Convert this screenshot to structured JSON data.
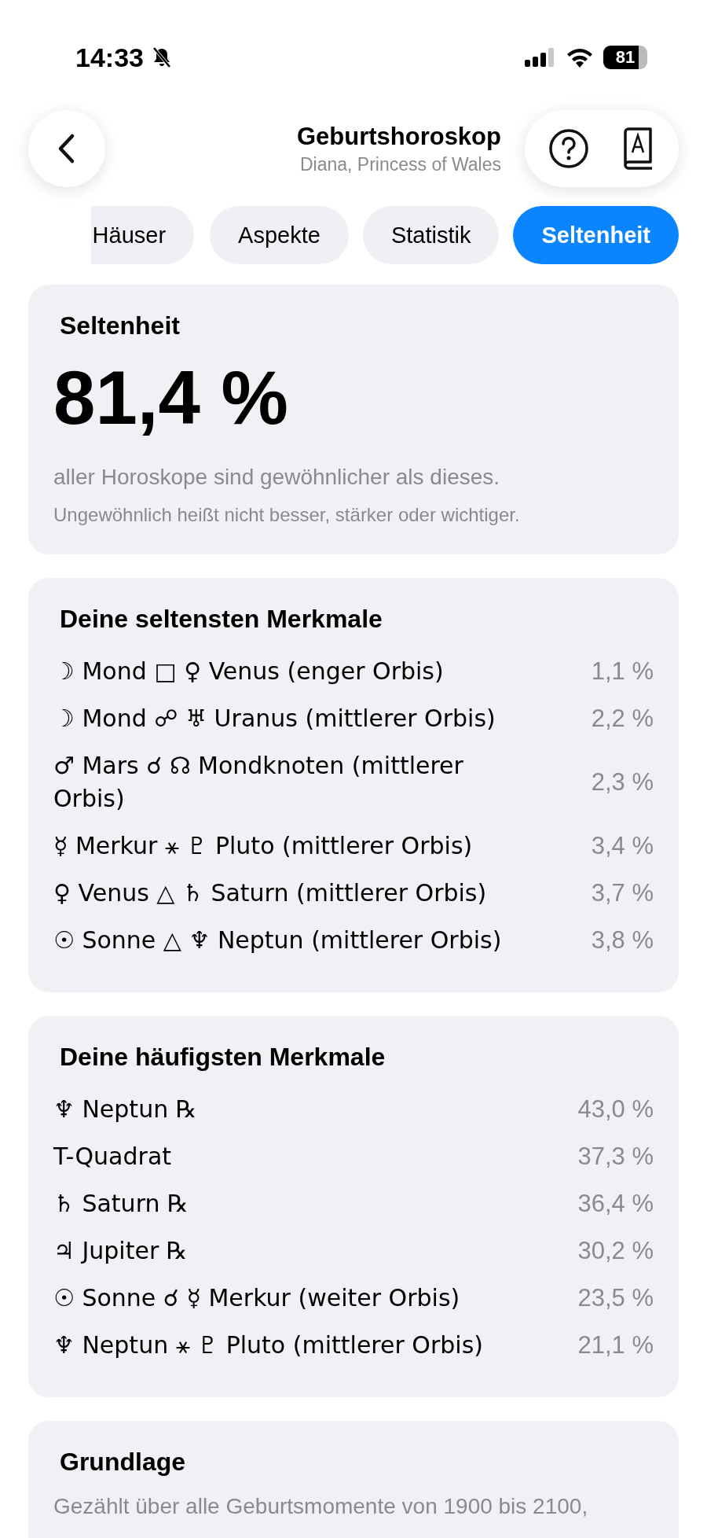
{
  "status_bar": {
    "time": "14:33",
    "silent": true,
    "battery": "81"
  },
  "header": {
    "title": "Geburtshoroskop",
    "subtitle": "Diana, Princess of Wales"
  },
  "tabs": [
    {
      "label": "Häuser",
      "selected": false
    },
    {
      "label": "Aspekte",
      "selected": false
    },
    {
      "label": "Statistik",
      "selected": false
    },
    {
      "label": "Seltenheit",
      "selected": true
    }
  ],
  "rarity": {
    "title": "Seltenheit",
    "value": "81,4 %",
    "caption": "aller Horoskope sind gewöhnlicher als dieses.",
    "note": "Ungewöhnlich heißt nicht besser, stärker oder wichtiger."
  },
  "rarest": {
    "title": "Deine seltensten Merkmale",
    "items": [
      {
        "label": "☽ Mond □ ♀ Venus (enger Orbis)",
        "value": "1,1 %"
      },
      {
        "label": "☽ Mond ☍ ♅ Uranus (mittlerer Orbis)",
        "value": "2,2 %"
      },
      {
        "label": "♂ Mars ☌ ☊ Mondknoten (mittlerer Orbis)",
        "value": "2,3 %"
      },
      {
        "label": "☿ Merkur ⚹ ♇ Pluto (mittlerer Orbis)",
        "value": "3,4 %"
      },
      {
        "label": "♀ Venus △ ♄ Saturn (mittlerer Orbis)",
        "value": "3,7 %"
      },
      {
        "label": "☉ Sonne △ ♆ Neptun (mittlerer Orbis)",
        "value": "3,8 %"
      }
    ]
  },
  "common": {
    "title": "Deine häufigsten Merkmale",
    "items": [
      {
        "label": "♆ Neptun ℞",
        "value": "43,0 %"
      },
      {
        "label": "T-Quadrat",
        "value": "37,3 %"
      },
      {
        "label": "♄ Saturn ℞",
        "value": "36,4 %"
      },
      {
        "label": "♃ Jupiter ℞",
        "value": "30,2 %"
      },
      {
        "label": "☉ Sonne ☌ ☿ Merkur (weiter Orbis)",
        "value": "23,5 %"
      },
      {
        "label": "♆ Neptun ⚹ ♇ Pluto (mittlerer Orbis)",
        "value": "21,1 %"
      }
    ]
  },
  "basis": {
    "title": "Grundlage",
    "text": "Gezählt über alle Geburtsmomente von 1900 bis 2100,"
  }
}
